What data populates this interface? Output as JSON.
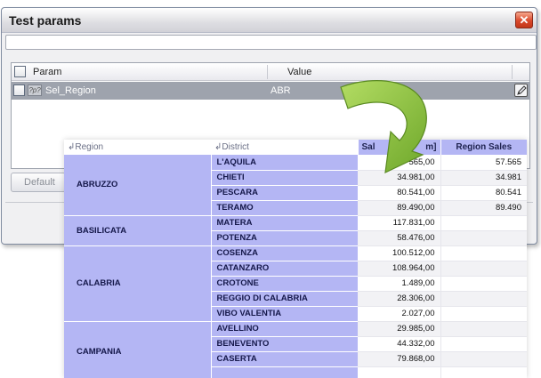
{
  "dialog": {
    "title": "Test params",
    "name_value": "",
    "grid": {
      "columns": [
        "Param",
        "Value"
      ],
      "row": {
        "param": "Sel_Region",
        "value": "ABR",
        "type_icon": "?p?"
      }
    },
    "default_label": "Default"
  },
  "pivot": {
    "headers": {
      "region": "Region",
      "district": "District",
      "sales": "Sal",
      "sales_tail": "m]",
      "region_sales": "Region Sales"
    },
    "groups": [
      {
        "region": "ABRUZZO",
        "rows": [
          {
            "district": "L'AQUILA",
            "sales": "565,00",
            "region_sales": "57.565"
          },
          {
            "district": "CHIETI",
            "sales": "34.981,00",
            "region_sales": "34.981"
          },
          {
            "district": "PESCARA",
            "sales": "80.541,00",
            "region_sales": "80.541"
          },
          {
            "district": "TERAMO",
            "sales": "89.490,00",
            "region_sales": "89.490"
          }
        ]
      },
      {
        "region": "BASILICATA",
        "rows": [
          {
            "district": "MATERA",
            "sales": "117.831,00",
            "region_sales": ""
          },
          {
            "district": "POTENZA",
            "sales": "58.476,00",
            "region_sales": ""
          }
        ]
      },
      {
        "region": "CALABRIA",
        "rows": [
          {
            "district": "COSENZA",
            "sales": "100.512,00",
            "region_sales": ""
          },
          {
            "district": "CATANZARO",
            "sales": "108.964,00",
            "region_sales": ""
          },
          {
            "district": "CROTONE",
            "sales": "1.489,00",
            "region_sales": ""
          },
          {
            "district": "REGGIO DI CALABRIA",
            "sales": "28.306,00",
            "region_sales": ""
          },
          {
            "district": "VIBO VALENTIA",
            "sales": "2.027,00",
            "region_sales": ""
          }
        ]
      },
      {
        "region": "CAMPANIA",
        "rows": [
          {
            "district": "AVELLINO",
            "sales": "29.985,00",
            "region_sales": ""
          },
          {
            "district": "BENEVENTO",
            "sales": "44.332,00",
            "region_sales": ""
          },
          {
            "district": "CASERTA",
            "sales": "79.868,00",
            "region_sales": ""
          },
          {
            "district": "",
            "sales": "",
            "region_sales": ""
          }
        ]
      }
    ]
  },
  "colors": {
    "accent": "#b4b6f4",
    "arrow": "#8ec63f",
    "close": "#d9482b",
    "selected_row": "#9ea3ad"
  },
  "icons": [
    "close-icon",
    "param-type-icon",
    "edit-icon",
    "curved-arrow-icon",
    "sort-icon"
  ]
}
